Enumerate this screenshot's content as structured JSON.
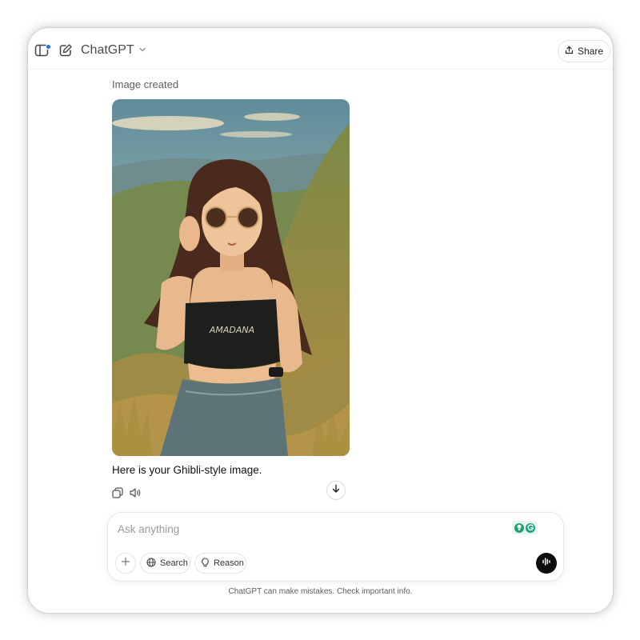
{
  "header": {
    "model_label": "ChatGPT",
    "share_label": "Share"
  },
  "message": {
    "status": "Image created",
    "reply_text": "Here is your Ghibli-style image.",
    "image_shirt_text": "AMADANA"
  },
  "composer": {
    "placeholder": "Ask anything",
    "search_label": "Search",
    "reason_label": "Reason"
  },
  "footer": {
    "disclaimer": "ChatGPT can make mistakes. Check important info."
  },
  "icons": {
    "sidebar": "sidebar-icon",
    "new_chat": "new-chat-icon",
    "model_chevron": "chevron-down-icon",
    "share": "share-upload-icon",
    "copy": "copy-icon",
    "read_aloud": "speaker-icon",
    "scroll_down": "arrow-down-icon",
    "attach": "plus-icon",
    "search": "globe-icon",
    "reason": "lightbulb-icon",
    "voice": "voice-waveform-icon"
  },
  "colors": {
    "notification_dot": "#1d6bf3",
    "voice_button": "#0d0d0d",
    "extension_green": "#18a36f"
  }
}
